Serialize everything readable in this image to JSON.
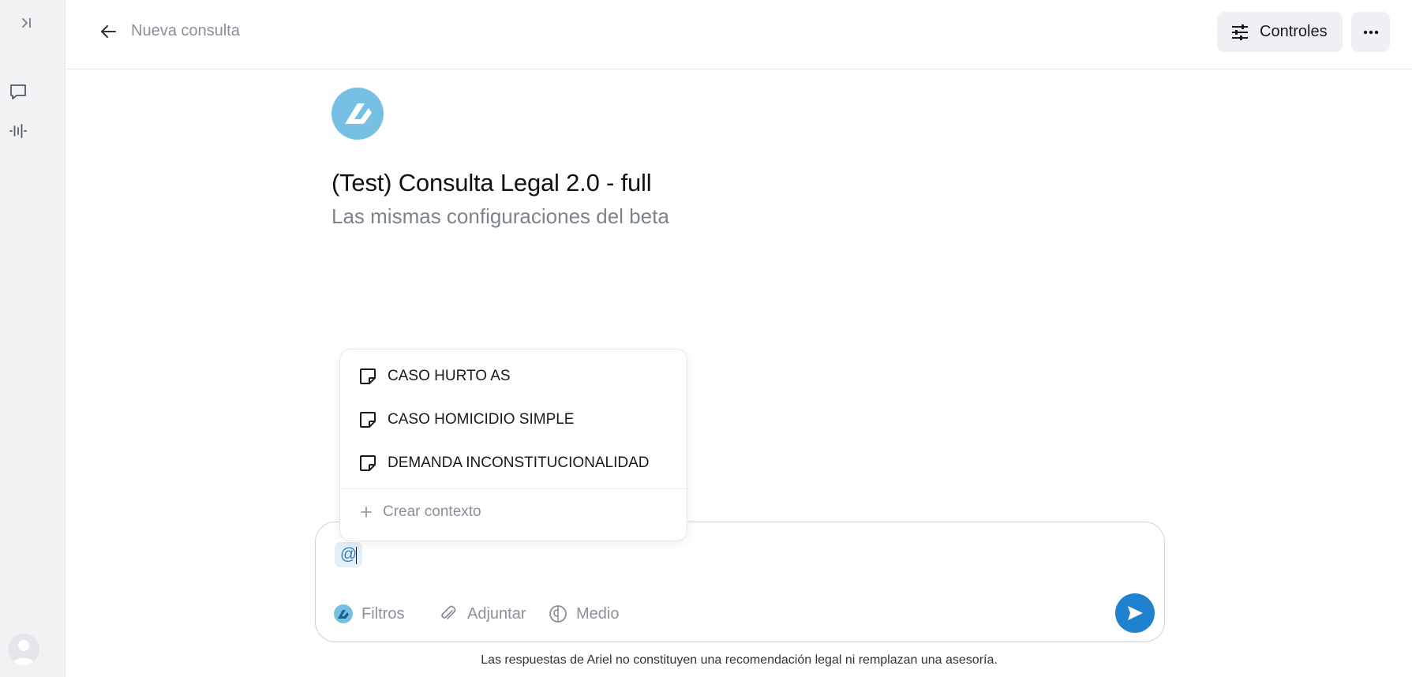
{
  "rail": {
    "icons": [
      "expand-sidebar-icon",
      "chat-icon",
      "voice-waveform-icon",
      "user-avatar-icon"
    ]
  },
  "header": {
    "title": "Nueva consulta",
    "controls_label": "Controles"
  },
  "assistant": {
    "title": "(Test) Consulta Legal 2.0 - full",
    "subtitle": "Las mismas configuraciones del beta",
    "logo_color": "#76c1e3"
  },
  "mention_menu": {
    "items": [
      {
        "label": "CASO HURTO AS",
        "icon": "note-icon"
      },
      {
        "label": "CASO HOMICIDIO SIMPLE",
        "icon": "note-icon"
      },
      {
        "label": "DEMANDA INCONSTITUCIONALIDAD",
        "icon": "note-icon"
      }
    ],
    "create_label": "Crear contexto"
  },
  "composer": {
    "value": "@",
    "tools": {
      "filters_label": "Filtros",
      "attach_label": "Adjuntar",
      "mode_label": "Medio"
    },
    "send_color": "#1e82cf"
  },
  "footer": {
    "disclaimer": "Las respuestas de Ariel no constituyen una recomendación legal ni remplazan una asesoría."
  }
}
